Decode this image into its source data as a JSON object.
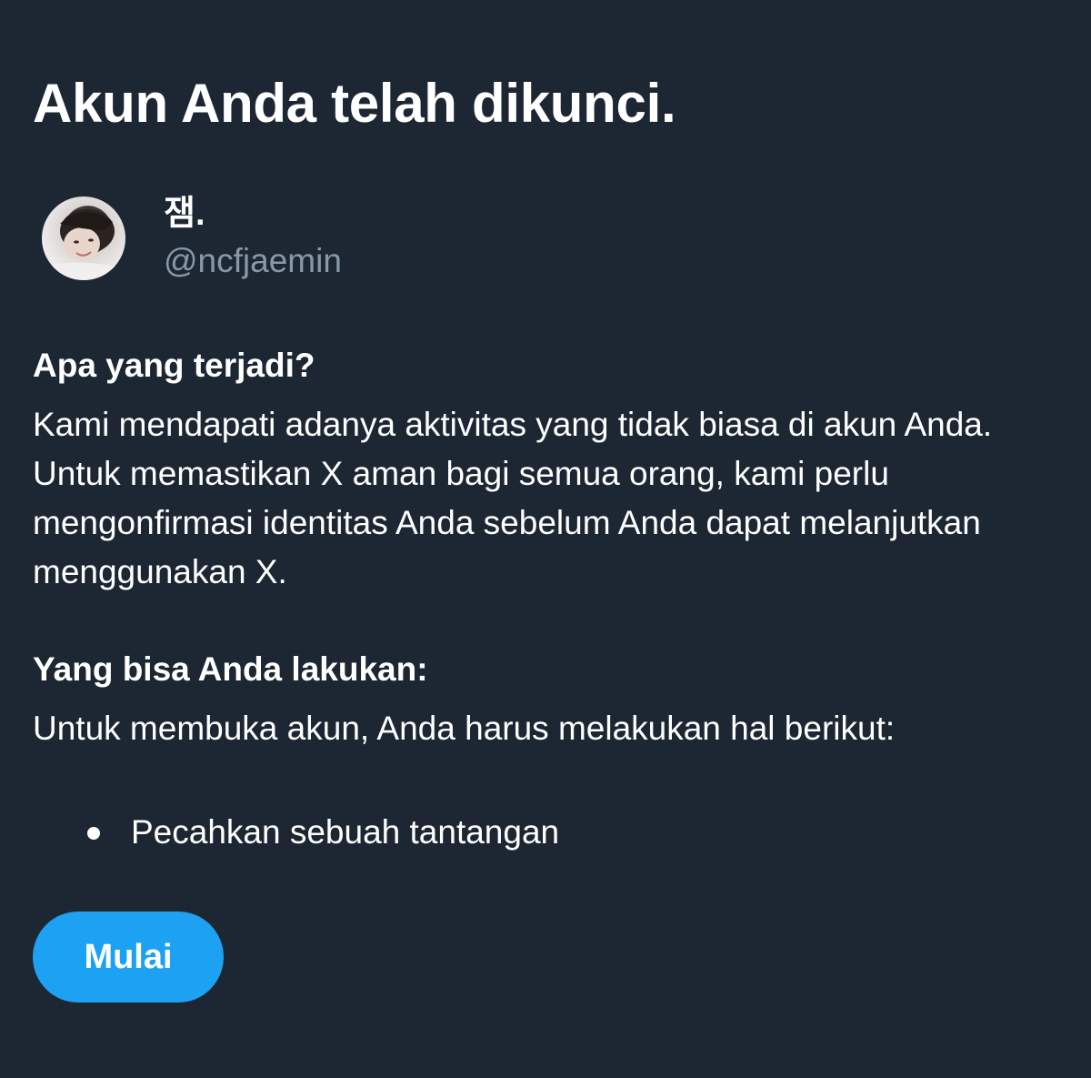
{
  "page": {
    "title": "Akun Anda telah dikunci."
  },
  "profile": {
    "display_name": "잼.",
    "handle": "@ncfjaemin"
  },
  "what_happened": {
    "heading": "Apa yang terjadi?",
    "body": "Kami mendapati adanya aktivitas yang tidak biasa di akun Anda. Untuk memastikan X aman bagi semua orang, kami perlu mengonfirmasi identitas Anda sebelum Anda dapat melanjutkan menggunakan X."
  },
  "what_you_can_do": {
    "heading": "Yang bisa Anda lakukan:",
    "body": "Untuk membuka akun, Anda harus melakukan hal berikut:",
    "steps": [
      "Pecahkan sebuah tantangan"
    ]
  },
  "actions": {
    "start_label": "Mulai"
  },
  "colors": {
    "background": "#1c2733",
    "text": "#ffffff",
    "secondary_text": "#8899a6",
    "accent": "#1da1f2"
  }
}
